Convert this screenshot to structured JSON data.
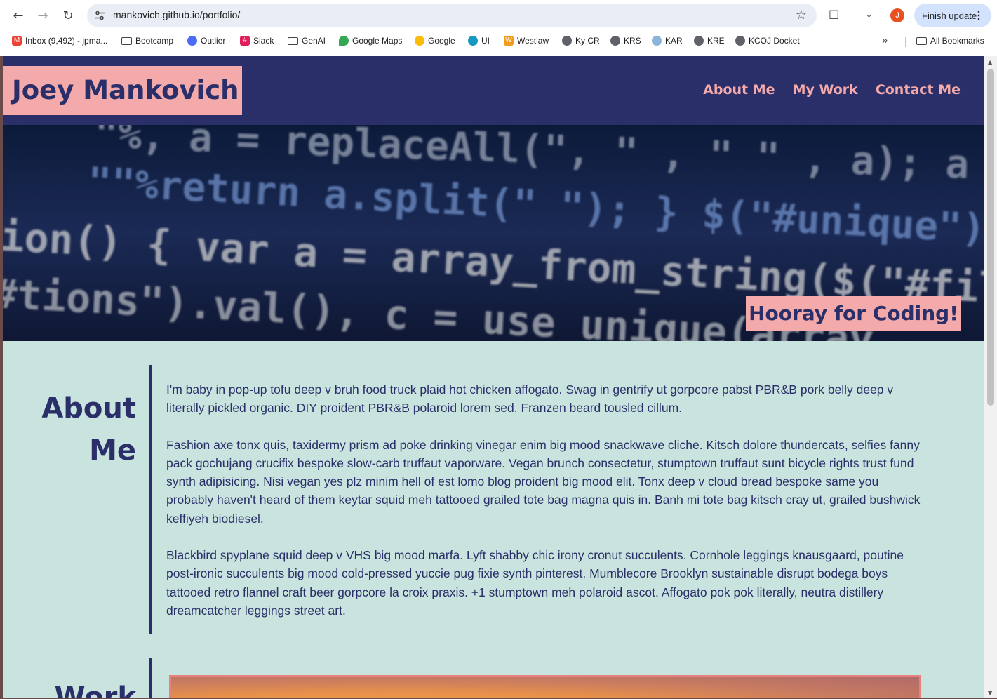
{
  "browser": {
    "url": "mankovich.github.io/portfolio/",
    "profile_initial": "J",
    "update_label": "Finish update",
    "bookmarks": [
      {
        "label": "Inbox (9,492) - jpma...",
        "icon": "gmail-icon"
      },
      {
        "label": "Bootcamp",
        "icon": "folder-icon"
      },
      {
        "label": "Outlier",
        "icon": "outlier-icon"
      },
      {
        "label": "Slack",
        "icon": "slack-icon"
      },
      {
        "label": "GenAI",
        "icon": "folder-icon"
      },
      {
        "label": "Google Maps",
        "icon": "maps-icon"
      },
      {
        "label": "Google",
        "icon": "google-icon"
      },
      {
        "label": "UI",
        "icon": "salesforce-icon"
      },
      {
        "label": "Westlaw",
        "icon": "westlaw-icon"
      },
      {
        "label": "Ky CR",
        "icon": "globe-icon"
      },
      {
        "label": "KRS",
        "icon": "globe-icon"
      },
      {
        "label": "KAR",
        "icon": "globe-icon"
      },
      {
        "label": "KRE",
        "icon": "globe-icon"
      },
      {
        "label": "KCOJ Docket",
        "icon": "globe-icon"
      }
    ],
    "all_bookmarks_label": "All Bookmarks"
  },
  "page": {
    "site_title": "Joey Mankovich",
    "nav": [
      "About Me",
      "My Work",
      "Contact Me"
    ],
    "hero_caption": "Hooray for Coding!",
    "hero_code_lines": [
      "\"%, a = replaceAll(\", \" , \" \" , a); a = a.repl",
      "\"\"%return a.split(\" \"); } $(\"#unique\").cli",
      "tion() { var a = array_from_string($(\"#file",
      "  \"#tions\").val(), c = use unique(array"
    ],
    "about": {
      "title_line1": "About",
      "title_line2": "Me",
      "paragraphs": [
        "I'm baby in pop-up tofu deep v bruh food truck plaid hot chicken affogato. Swag in gentrify ut gorpcore pabst PBR&B pork belly deep v literally pickled organic. DIY proident PBR&B polaroid lorem sed. Franzen beard tousled cillum.",
        "Fashion axe tonx quis, taxidermy prism ad poke drinking vinegar enim big mood snackwave cliche. Kitsch dolore thundercats, selfies fanny pack gochujang crucifix bespoke slow-carb truffaut vaporware. Vegan brunch consectetur, stumptown truffaut sunt bicycle rights trust fund synth adipisicing. Nisi vegan yes plz minim hell of est lomo blog proident big mood elit. Tonx deep v cloud bread bespoke same you probably haven't heard of them keytar squid meh tattooed grailed tote bag magna quis in. Banh mi tote bag kitsch cray ut, grailed bushwick keffiyeh biodiesel.",
        "Blackbird spyplane squid deep v VHS big mood marfa. Lyft shabby chic irony cronut succulents. Cornhole leggings knausgaard, poutine post-ironic succulents big mood cold-pressed yuccie pug fixie synth pinterest. Mumblecore Brooklyn sustainable disrupt bodega boys tattooed retro flannel craft beer gorpcore la croix praxis. +1 stumptown meh polaroid ascot. Affogato pok pok literally, neutra distillery dreamcatcher leggings street art."
      ]
    },
    "work": {
      "title": "Work"
    }
  },
  "colors": {
    "navy": "#2a2f69",
    "pink": "#f4aaaa",
    "mint": "#c9e4de"
  }
}
